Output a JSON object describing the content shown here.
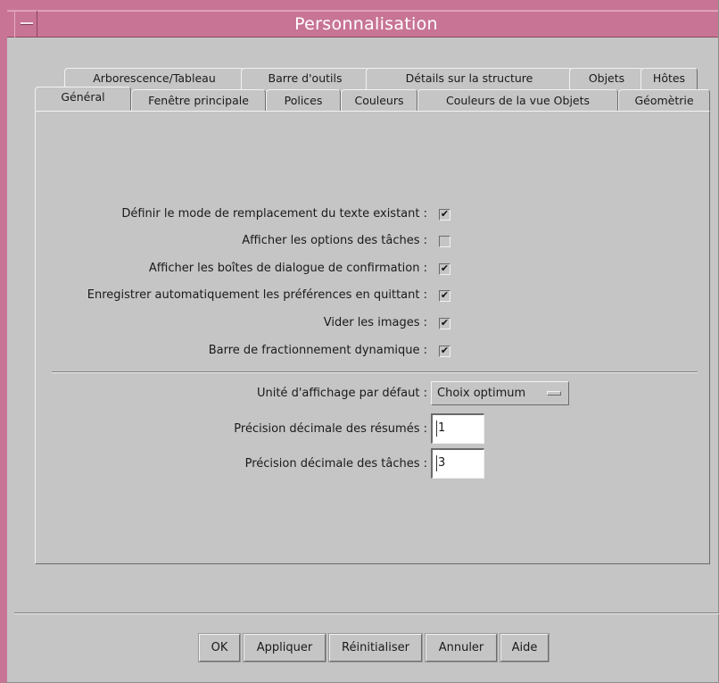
{
  "window": {
    "title": "Personnalisation"
  },
  "tabs": {
    "back_row": [
      {
        "label": "Arborescence/Tableau"
      },
      {
        "label": "Barre d'outils"
      },
      {
        "label": "Détails sur la structure"
      },
      {
        "label": "Objets"
      },
      {
        "label": "Hôtes"
      }
    ],
    "front_row": [
      {
        "label": "Général",
        "active": true
      },
      {
        "label": "Fenêtre principale"
      },
      {
        "label": "Polices"
      },
      {
        "label": "Couleurs"
      },
      {
        "label": "Couleurs de la vue Objets"
      },
      {
        "label": "Géomètrie"
      }
    ]
  },
  "options": [
    {
      "label": "Définir le mode de remplacement du texte existant :",
      "checked": true
    },
    {
      "label": "Afficher les options des tâches :",
      "checked": false
    },
    {
      "label": "Afficher les boîtes de dialogue de confirmation :",
      "checked": true
    },
    {
      "label": "Enregistrer automatiquement les préférences en quittant :",
      "checked": true
    },
    {
      "label": "Vider les images :",
      "checked": true
    },
    {
      "label": "Barre de fractionnement dynamique :",
      "checked": true
    }
  ],
  "fields": {
    "unit": {
      "label": "Unité d'affichage par défaut :",
      "value": "Choix optimum"
    },
    "summary_precision": {
      "label": "Précision décimale des résumés :",
      "value": "1"
    },
    "task_precision": {
      "label": "Précision décimale des tâches :",
      "value": "3"
    }
  },
  "buttons": {
    "ok": "OK",
    "apply": "Appliquer",
    "reset": "Réinitialiser",
    "cancel": "Annuler",
    "help": "Aide"
  },
  "colors": {
    "titlebar": "#c87595",
    "background": "#c5c5c5"
  },
  "icons": {
    "check": "✔"
  }
}
